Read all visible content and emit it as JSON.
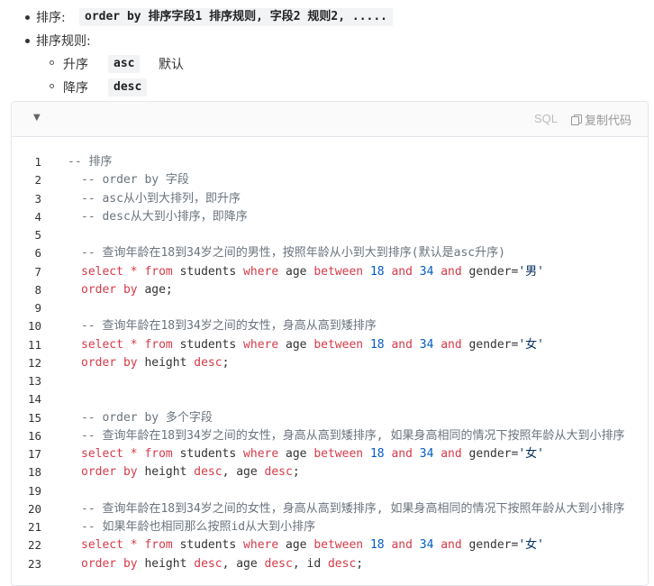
{
  "bullets": {
    "sort_label": "排序:",
    "sort_code": "order by 排序字段1 排序规则, 字段2 规则2, .....",
    "rules_label": "排序规则:",
    "asc_label": "升序",
    "asc_code": "asc",
    "asc_note": "默认",
    "desc_label": "降序",
    "desc_code": "desc"
  },
  "codeblock": {
    "language": "SQL",
    "copy_label": "复制代码",
    "lines": [
      {
        "n": "1",
        "parts": [
          {
            "t": "-- 排序",
            "c": "c-com"
          }
        ],
        "indent": 0
      },
      {
        "n": "2",
        "parts": [
          {
            "t": "-- order by 字段",
            "c": "c-com"
          }
        ],
        "indent": 2
      },
      {
        "n": "3",
        "parts": [
          {
            "t": "-- asc从小到大排列，即升序",
            "c": "c-com"
          }
        ],
        "indent": 2
      },
      {
        "n": "4",
        "parts": [
          {
            "t": "-- desc从大到小排序，即降序",
            "c": "c-com"
          }
        ],
        "indent": 2
      },
      {
        "n": "5",
        "parts": [],
        "indent": 2
      },
      {
        "n": "6",
        "parts": [
          {
            "t": "-- 查询年龄在18到34岁之间的男性，按照年龄从小到大到排序(默认是asc升序)",
            "c": "c-com"
          }
        ],
        "indent": 2
      },
      {
        "n": "7",
        "parts": [
          {
            "t": "select",
            "c": "c-kw"
          },
          {
            "t": " "
          },
          {
            "t": "*",
            "c": "c-kw"
          },
          {
            "t": " "
          },
          {
            "t": "from",
            "c": "c-kw"
          },
          {
            "t": " students "
          },
          {
            "t": "where",
            "c": "c-kw"
          },
          {
            "t": " age "
          },
          {
            "t": "between",
            "c": "c-kw"
          },
          {
            "t": " "
          },
          {
            "t": "18",
            "c": "c-num"
          },
          {
            "t": " "
          },
          {
            "t": "and",
            "c": "c-kw"
          },
          {
            "t": " "
          },
          {
            "t": "34",
            "c": "c-num"
          },
          {
            "t": " "
          },
          {
            "t": "and",
            "c": "c-kw"
          },
          {
            "t": " gender="
          },
          {
            "t": "'男'",
            "c": "c-str"
          }
        ],
        "indent": 2
      },
      {
        "n": "8",
        "parts": [
          {
            "t": "order",
            "c": "c-kw"
          },
          {
            "t": " "
          },
          {
            "t": "by",
            "c": "c-kw"
          },
          {
            "t": " age;"
          }
        ],
        "indent": 2
      },
      {
        "n": "9",
        "parts": [],
        "indent": 2
      },
      {
        "n": "10",
        "parts": [
          {
            "t": "-- 查询年龄在18到34岁之间的女性，身高从高到矮排序",
            "c": "c-com"
          }
        ],
        "indent": 2
      },
      {
        "n": "11",
        "parts": [
          {
            "t": "select",
            "c": "c-kw"
          },
          {
            "t": " "
          },
          {
            "t": "*",
            "c": "c-kw"
          },
          {
            "t": " "
          },
          {
            "t": "from",
            "c": "c-kw"
          },
          {
            "t": " students "
          },
          {
            "t": "where",
            "c": "c-kw"
          },
          {
            "t": " age "
          },
          {
            "t": "between",
            "c": "c-kw"
          },
          {
            "t": " "
          },
          {
            "t": "18",
            "c": "c-num"
          },
          {
            "t": " "
          },
          {
            "t": "and",
            "c": "c-kw"
          },
          {
            "t": " "
          },
          {
            "t": "34",
            "c": "c-num"
          },
          {
            "t": " "
          },
          {
            "t": "and",
            "c": "c-kw"
          },
          {
            "t": " gender="
          },
          {
            "t": "'女'",
            "c": "c-str"
          }
        ],
        "indent": 2
      },
      {
        "n": "12",
        "parts": [
          {
            "t": "order",
            "c": "c-kw"
          },
          {
            "t": " "
          },
          {
            "t": "by",
            "c": "c-kw"
          },
          {
            "t": " height "
          },
          {
            "t": "desc",
            "c": "c-kw"
          },
          {
            "t": ";"
          }
        ],
        "indent": 2
      },
      {
        "n": "13",
        "parts": [],
        "indent": 2
      },
      {
        "n": "14",
        "parts": [],
        "indent": 2
      },
      {
        "n": "15",
        "parts": [
          {
            "t": "-- order by 多个字段",
            "c": "c-com"
          }
        ],
        "indent": 2
      },
      {
        "n": "16",
        "parts": [
          {
            "t": "-- 查询年龄在18到34岁之间的女性，身高从高到矮排序, 如果身高相同的情况下按照年龄从大到小排序",
            "c": "c-com"
          }
        ],
        "indent": 2
      },
      {
        "n": "17",
        "parts": [
          {
            "t": "select",
            "c": "c-kw"
          },
          {
            "t": " "
          },
          {
            "t": "*",
            "c": "c-kw"
          },
          {
            "t": " "
          },
          {
            "t": "from",
            "c": "c-kw"
          },
          {
            "t": " students "
          },
          {
            "t": "where",
            "c": "c-kw"
          },
          {
            "t": " age "
          },
          {
            "t": "between",
            "c": "c-kw"
          },
          {
            "t": " "
          },
          {
            "t": "18",
            "c": "c-num"
          },
          {
            "t": " "
          },
          {
            "t": "and",
            "c": "c-kw"
          },
          {
            "t": " "
          },
          {
            "t": "34",
            "c": "c-num"
          },
          {
            "t": " "
          },
          {
            "t": "and",
            "c": "c-kw"
          },
          {
            "t": " gender="
          },
          {
            "t": "'女'",
            "c": "c-str"
          }
        ],
        "indent": 2
      },
      {
        "n": "18",
        "parts": [
          {
            "t": "order",
            "c": "c-kw"
          },
          {
            "t": " "
          },
          {
            "t": "by",
            "c": "c-kw"
          },
          {
            "t": " height "
          },
          {
            "t": "desc",
            "c": "c-kw"
          },
          {
            "t": ", age "
          },
          {
            "t": "desc",
            "c": "c-kw"
          },
          {
            "t": ";"
          }
        ],
        "indent": 2
      },
      {
        "n": "19",
        "parts": [],
        "indent": 2
      },
      {
        "n": "20",
        "parts": [
          {
            "t": "-- 查询年龄在18到34岁之间的女性，身高从高到矮排序, 如果身高相同的情况下按照年龄从大到小排序",
            "c": "c-com"
          }
        ],
        "indent": 2
      },
      {
        "n": "21",
        "parts": [
          {
            "t": "-- 如果年龄也相同那么按照id从大到小排序",
            "c": "c-com"
          }
        ],
        "indent": 2
      },
      {
        "n": "22",
        "parts": [
          {
            "t": "select",
            "c": "c-kw"
          },
          {
            "t": " "
          },
          {
            "t": "*",
            "c": "c-kw"
          },
          {
            "t": " "
          },
          {
            "t": "from",
            "c": "c-kw"
          },
          {
            "t": " students "
          },
          {
            "t": "where",
            "c": "c-kw"
          },
          {
            "t": " age "
          },
          {
            "t": "between",
            "c": "c-kw"
          },
          {
            "t": " "
          },
          {
            "t": "18",
            "c": "c-num"
          },
          {
            "t": " "
          },
          {
            "t": "and",
            "c": "c-kw"
          },
          {
            "t": " "
          },
          {
            "t": "34",
            "c": "c-num"
          },
          {
            "t": " "
          },
          {
            "t": "and",
            "c": "c-kw"
          },
          {
            "t": " gender="
          },
          {
            "t": "'女'",
            "c": "c-str"
          }
        ],
        "indent": 2
      },
      {
        "n": "23",
        "parts": [
          {
            "t": "order",
            "c": "c-kw"
          },
          {
            "t": " "
          },
          {
            "t": "by",
            "c": "c-kw"
          },
          {
            "t": " height "
          },
          {
            "t": "desc",
            "c": "c-kw"
          },
          {
            "t": ", age "
          },
          {
            "t": "desc",
            "c": "c-kw"
          },
          {
            "t": ", id "
          },
          {
            "t": "desc",
            "c": "c-kw"
          },
          {
            "t": ";"
          }
        ],
        "indent": 2
      }
    ]
  }
}
